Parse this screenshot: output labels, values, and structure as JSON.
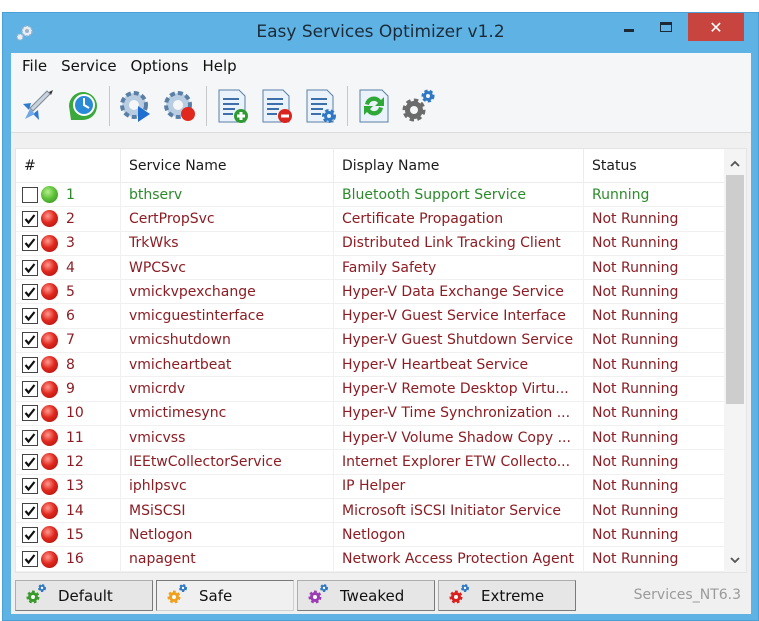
{
  "window": {
    "title": "Easy Services Optimizer v1.2",
    "close_glyph": "✕"
  },
  "menu": [
    "File",
    "Service",
    "Options",
    "Help"
  ],
  "toolbar": {
    "buttons": [
      {
        "name": "optimize-rocket-icon"
      },
      {
        "name": "restore-clock-icon"
      },
      {
        "name": "start-service-icon"
      },
      {
        "name": "stop-service-icon"
      },
      {
        "name": "add-to-list-icon"
      },
      {
        "name": "remove-from-list-icon"
      },
      {
        "name": "edit-list-icon"
      },
      {
        "name": "refresh-icon"
      },
      {
        "name": "services-settings-icon"
      }
    ]
  },
  "grid": {
    "columns": [
      "#",
      "Service Name",
      "Display Name",
      "Status"
    ],
    "rows": [
      {
        "checked": false,
        "running": true,
        "num": "1",
        "service": "bthserv",
        "display": "Bluetooth Support Service",
        "status": "Running"
      },
      {
        "checked": true,
        "running": false,
        "num": "2",
        "service": "CertPropSvc",
        "display": "Certificate Propagation",
        "status": "Not Running"
      },
      {
        "checked": true,
        "running": false,
        "num": "3",
        "service": "TrkWks",
        "display": "Distributed Link Tracking Client",
        "status": "Not Running"
      },
      {
        "checked": true,
        "running": false,
        "num": "4",
        "service": "WPCSvc",
        "display": "Family Safety",
        "status": "Not Running"
      },
      {
        "checked": true,
        "running": false,
        "num": "5",
        "service": "vmickvpexchange",
        "display": "Hyper-V Data Exchange Service",
        "status": "Not Running"
      },
      {
        "checked": true,
        "running": false,
        "num": "6",
        "service": "vmicguestinterface",
        "display": "Hyper-V Guest Service Interface",
        "status": "Not Running"
      },
      {
        "checked": true,
        "running": false,
        "num": "7",
        "service": "vmicshutdown",
        "display": "Hyper-V Guest Shutdown Service",
        "status": "Not Running"
      },
      {
        "checked": true,
        "running": false,
        "num": "8",
        "service": "vmicheartbeat",
        "display": "Hyper-V Heartbeat Service",
        "status": "Not Running"
      },
      {
        "checked": true,
        "running": false,
        "num": "9",
        "service": "vmicrdv",
        "display": "Hyper-V Remote Desktop Virtu...",
        "status": "Not Running"
      },
      {
        "checked": true,
        "running": false,
        "num": "10",
        "service": "vmictimesync",
        "display": "Hyper-V Time Synchronization ...",
        "status": "Not Running"
      },
      {
        "checked": true,
        "running": false,
        "num": "11",
        "service": "vmicvss",
        "display": "Hyper-V Volume Shadow Copy ...",
        "status": "Not Running"
      },
      {
        "checked": true,
        "running": false,
        "num": "12",
        "service": "IEEtwCollectorService",
        "display": "Internet Explorer ETW Collecto...",
        "status": "Not Running"
      },
      {
        "checked": true,
        "running": false,
        "num": "13",
        "service": "iphlpsvc",
        "display": "IP Helper",
        "status": "Not Running"
      },
      {
        "checked": true,
        "running": false,
        "num": "14",
        "service": "MSiSCSI",
        "display": "Microsoft iSCSI Initiator Service",
        "status": "Not Running"
      },
      {
        "checked": true,
        "running": false,
        "num": "15",
        "service": "Netlogon",
        "display": "Netlogon",
        "status": "Not Running"
      },
      {
        "checked": true,
        "running": false,
        "num": "16",
        "service": "napagent",
        "display": "Network Access Protection Agent",
        "status": "Not Running"
      }
    ],
    "scroll": {
      "thumb_start_fraction": 0.0,
      "thumb_size_fraction": 0.61
    },
    "scroll_up_glyph": "▲",
    "scroll_down_glyph": "▼"
  },
  "presets": [
    {
      "label": "Default",
      "gear_color": "#3a9a2c",
      "active": false
    },
    {
      "label": "Safe",
      "gear_color": "#f0a020",
      "active": true
    },
    {
      "label": "Tweaked",
      "gear_color": "#9b3cb4",
      "active": false
    },
    {
      "label": "Extreme",
      "gear_color": "#d8201e",
      "active": false
    }
  ],
  "status_label": "Services_NT6.3",
  "colors": {
    "running": "#2c8a2c",
    "stopped": "#8b1d24",
    "title_bar": "#5eb3e4",
    "close_button": "#c8453f",
    "small_gear": "#2f78c4"
  }
}
